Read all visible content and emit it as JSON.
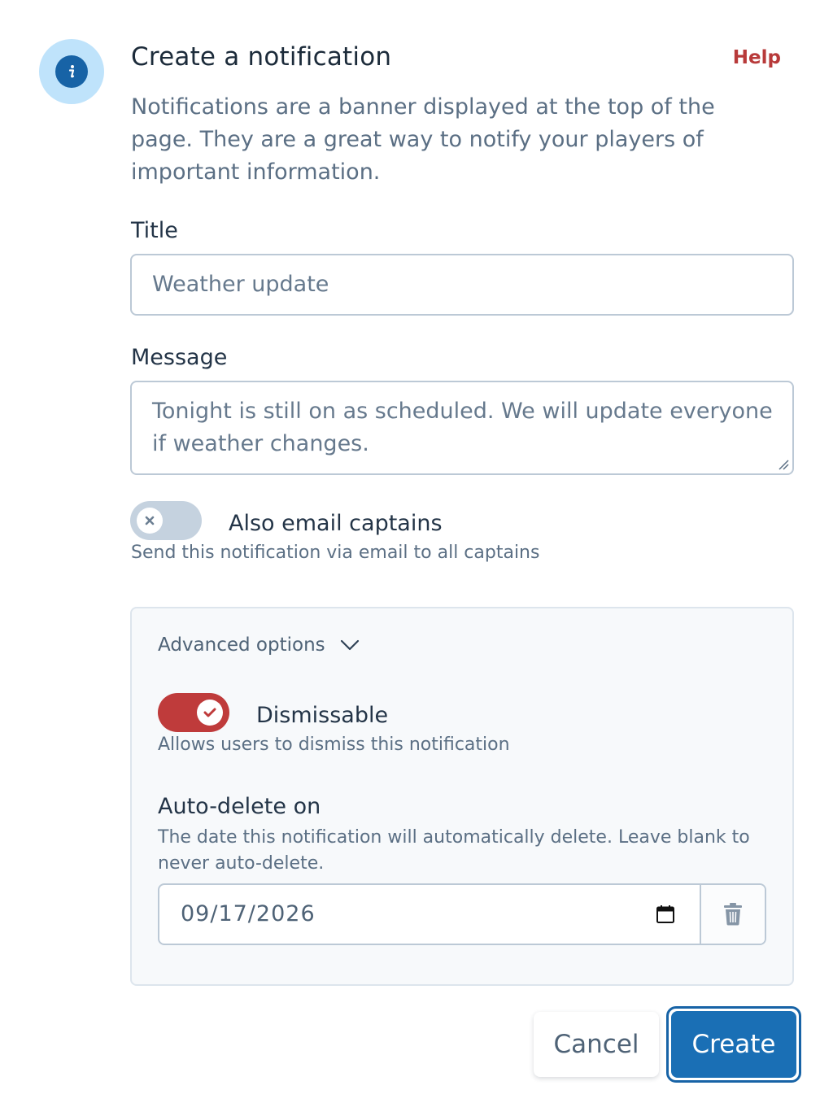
{
  "dialog": {
    "title": "Create a notification",
    "help_link": "Help",
    "description": "Notifications are a banner displayed at the top of the page. They are a great way to notify your players of important information."
  },
  "fields": {
    "title_label": "Title",
    "title_value": "Weather update",
    "message_label": "Message",
    "message_value": "Tonight is still on as scheduled. We will update everyone if weather changes."
  },
  "email_captains": {
    "label": "Also email captains",
    "description": "Send this notification via email to all captains",
    "enabled": false
  },
  "advanced": {
    "header": "Advanced options",
    "expanded": true,
    "dismissable": {
      "label": "Dismissable",
      "description": "Allows users to dismiss this notification",
      "enabled": true
    },
    "auto_delete": {
      "label": "Auto-delete on",
      "description": "The date this notification will automatically delete. Leave blank to never auto-delete.",
      "value": "09/17/2026"
    }
  },
  "actions": {
    "cancel_label": "Cancel",
    "create_label": "Create"
  },
  "icons": {
    "header": "info-icon",
    "toggle_off": "x-icon",
    "toggle_on": "check-icon",
    "chevron": "chevron-down-icon",
    "calendar": "calendar-icon",
    "trash": "trash-icon"
  },
  "colors": {
    "primary": "#1a6fb5",
    "danger_accent": "#bf3b3b",
    "info_circle_bg": "#bfe3fb",
    "info_dot": "#1763a6"
  }
}
